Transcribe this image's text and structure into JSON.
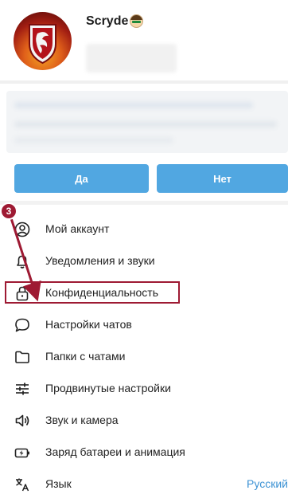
{
  "profile": {
    "name": "Scryde"
  },
  "prompt_buttons": {
    "yes_label": "Да",
    "no_label": "Нет"
  },
  "annotation": {
    "step_number": "3",
    "color": "#9e1a33"
  },
  "menu": {
    "items": [
      {
        "label": "Мой аккаунт",
        "icon": "account-icon"
      },
      {
        "label": "Уведомления и звуки",
        "icon": "bell-icon"
      },
      {
        "label": "Конфиденциальность",
        "icon": "lock-icon",
        "highlighted": true
      },
      {
        "label": "Настройки чатов",
        "icon": "chat-bubble-icon"
      },
      {
        "label": "Папки с чатами",
        "icon": "folder-icon"
      },
      {
        "label": "Продвинутые настройки",
        "icon": "sliders-icon"
      },
      {
        "label": "Звук и камера",
        "icon": "speaker-icon"
      },
      {
        "label": "Заряд батареи и анимация",
        "icon": "battery-icon"
      },
      {
        "label": "Язык",
        "icon": "language-icon",
        "value": "Русский"
      }
    ]
  },
  "colors": {
    "accent": "#51a7e1",
    "link": "#3c92d4"
  }
}
